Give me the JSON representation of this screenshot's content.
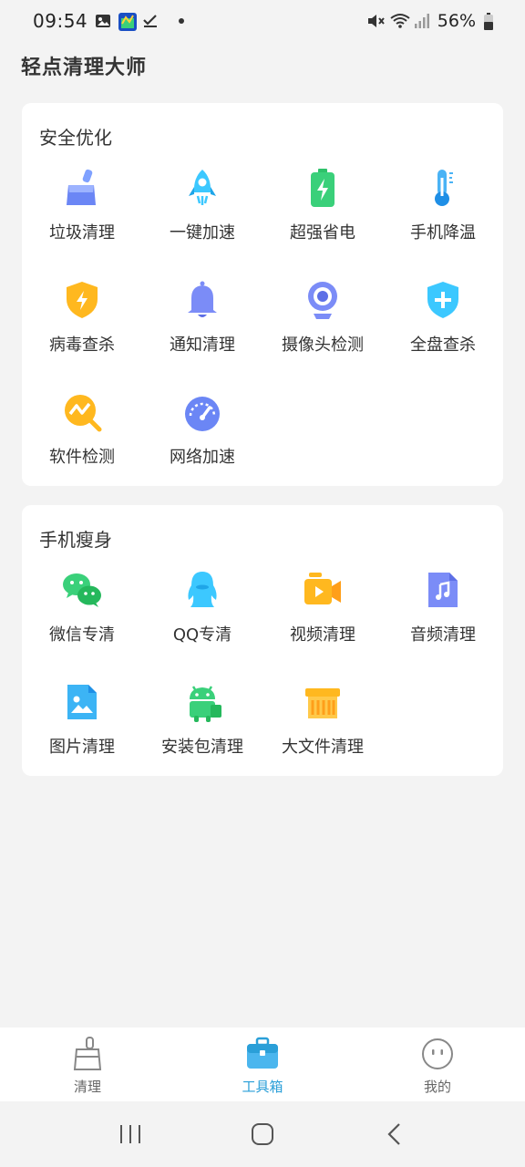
{
  "status_bar": {
    "time": "09:54",
    "battery": "56%"
  },
  "app": {
    "title": "轻点清理大师"
  },
  "sections": [
    {
      "title": "安全优化",
      "items": [
        {
          "label": "垃圾清理",
          "icon": "broom-icon"
        },
        {
          "label": "一键加速",
          "icon": "rocket-icon"
        },
        {
          "label": "超强省电",
          "icon": "battery-icon"
        },
        {
          "label": "手机降温",
          "icon": "thermometer-icon"
        },
        {
          "label": "病毒查杀",
          "icon": "shield-bolt-icon"
        },
        {
          "label": "通知清理",
          "icon": "bell-icon"
        },
        {
          "label": "摄像头检测",
          "icon": "webcam-icon"
        },
        {
          "label": "全盘查杀",
          "icon": "shield-plus-icon"
        },
        {
          "label": "软件检测",
          "icon": "scan-chart-icon"
        },
        {
          "label": "网络加速",
          "icon": "speedometer-icon"
        }
      ]
    },
    {
      "title": "手机瘦身",
      "items": [
        {
          "label": "微信专清",
          "icon": "wechat-icon"
        },
        {
          "label": "QQ专清",
          "icon": "qq-penguin-icon"
        },
        {
          "label": "视频清理",
          "icon": "video-icon"
        },
        {
          "label": "音频清理",
          "icon": "music-file-icon"
        },
        {
          "label": "图片清理",
          "icon": "image-file-icon"
        },
        {
          "label": "安装包清理",
          "icon": "android-icon"
        },
        {
          "label": "大文件清理",
          "icon": "big-file-icon"
        }
      ]
    }
  ],
  "bottom_nav": [
    {
      "label": "清理",
      "icon": "broom-outline-icon",
      "active": false
    },
    {
      "label": "工具箱",
      "icon": "toolbox-icon",
      "active": true
    },
    {
      "label": "我的",
      "icon": "smiley-face-icon",
      "active": false
    }
  ],
  "colors": {
    "accent": "#2a9fd8",
    "background": "#f3f3f3"
  }
}
